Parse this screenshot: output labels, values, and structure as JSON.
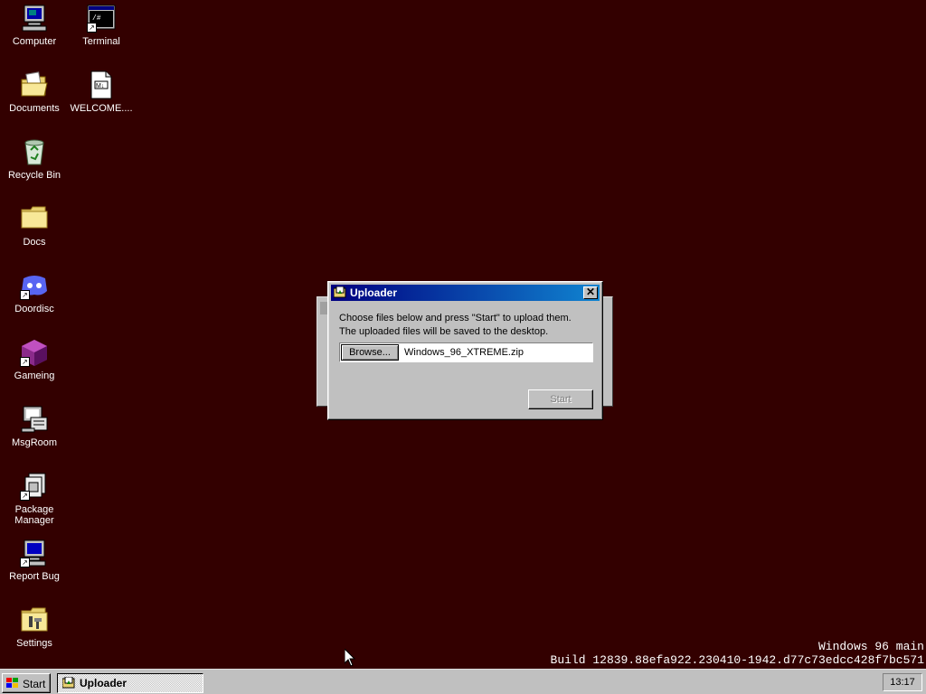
{
  "desktop": {
    "icons": [
      {
        "label": "Computer",
        "icon": "computer-icon",
        "shortcut": false
      },
      {
        "label": "Terminal",
        "icon": "terminal-icon",
        "shortcut": true
      },
      {
        "label": "Documents",
        "icon": "documents-folder-icon",
        "shortcut": false
      },
      {
        "label": "WELCOME....",
        "icon": "markdown-file-icon",
        "shortcut": false
      },
      {
        "label": "Recycle Bin",
        "icon": "recycle-bin-icon",
        "shortcut": false
      },
      {
        "label": "Docs",
        "icon": "folder-icon",
        "shortcut": false
      },
      {
        "label": "Doordisc",
        "icon": "discord-icon",
        "shortcut": true
      },
      {
        "label": "Gameing",
        "icon": "game-cube-icon",
        "shortcut": true
      },
      {
        "label": "MsgRoom",
        "icon": "msgroom-icon",
        "shortcut": false
      },
      {
        "label": "Package Manager",
        "icon": "package-manager-icon",
        "shortcut": true
      },
      {
        "label": "Report Bug",
        "icon": "report-bug-icon",
        "shortcut": true
      },
      {
        "label": "Settings",
        "icon": "settings-icon",
        "shortcut": false
      }
    ],
    "build": {
      "line1": "Windows 96 main",
      "line2": "Build 12839.88efa922.230410-1942.d77c73edcc428f7bc571"
    },
    "background_color": "#330000"
  },
  "uploader": {
    "title": "Uploader",
    "message_line1": "Choose files below and press \"Start\" to upload them.",
    "message_line2": "The uploaded files will be saved to the desktop.",
    "browse_label": "Browse...",
    "file_name": "Windows_96_XTREME.zip",
    "start_label": "Start",
    "close_glyph": "✕"
  },
  "taskbar": {
    "start_label": "Start",
    "tasks": [
      {
        "label": "Uploader"
      }
    ],
    "clock": "13:17"
  }
}
